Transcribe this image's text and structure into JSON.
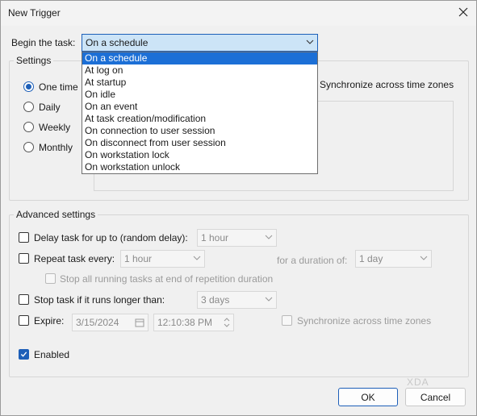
{
  "window": {
    "title": "New Trigger"
  },
  "begin": {
    "label": "Begin the task:",
    "value": "On a schedule",
    "options": [
      "On a schedule",
      "At log on",
      "At startup",
      "On idle",
      "On an event",
      "At task creation/modification",
      "On connection to user session",
      "On disconnect from user session",
      "On workstation lock",
      "On workstation unlock"
    ]
  },
  "settings": {
    "title": "Settings",
    "radios": [
      "One time",
      "Daily",
      "Weekly",
      "Monthly"
    ],
    "sync": "Synchronize across time zones"
  },
  "advanced": {
    "title": "Advanced settings",
    "delay_label": "Delay task for up to (random delay):",
    "delay_value": "1 hour",
    "repeat_label": "Repeat task every:",
    "repeat_value": "1 hour",
    "duration_label": "for a duration of:",
    "duration_value": "1 day",
    "stop_all_label": "Stop all running tasks at end of repetition duration",
    "stop_longer_label": "Stop task if it runs longer than:",
    "stop_longer_value": "3 days",
    "expire_label": "Expire:",
    "expire_date": "3/15/2024",
    "expire_time": "12:10:38 PM",
    "expire_sync": "Synchronize across time zones",
    "enabled_label": "Enabled"
  },
  "buttons": {
    "ok": "OK",
    "cancel": "Cancel"
  },
  "colors": {
    "accent": "#1d5fb8",
    "highlight": "#1c6fd6"
  },
  "watermark": "XDA"
}
